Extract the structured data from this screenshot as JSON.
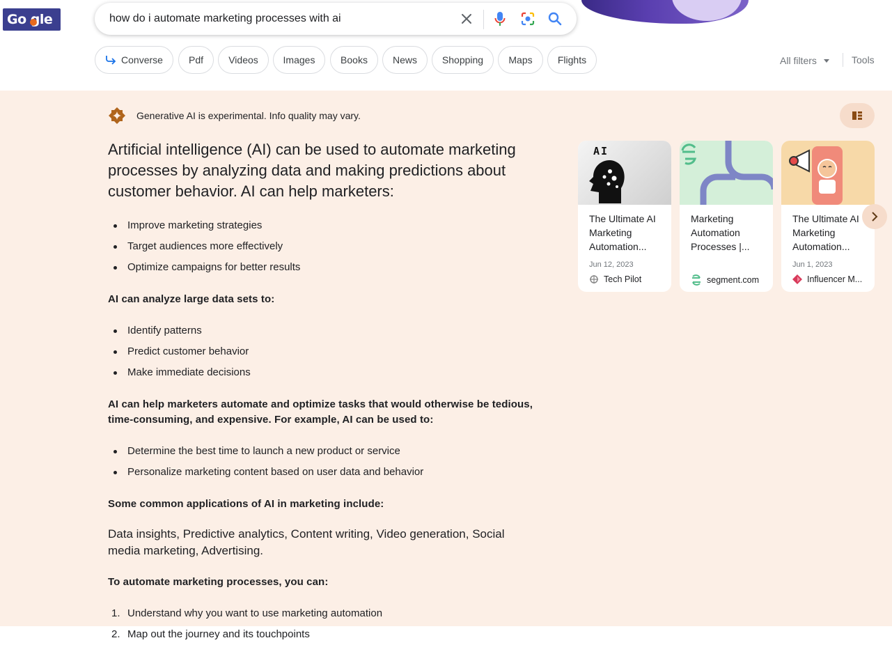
{
  "logo": {
    "text": "Go  gle"
  },
  "search": {
    "query": "how do i automate marketing processes with ai"
  },
  "chips": [
    {
      "label": "Converse"
    },
    {
      "label": "Pdf"
    },
    {
      "label": "Videos"
    },
    {
      "label": "Images"
    },
    {
      "label": "Books"
    },
    {
      "label": "News"
    },
    {
      "label": "Shopping"
    },
    {
      "label": "Maps"
    },
    {
      "label": "Flights"
    }
  ],
  "toolbar": {
    "filters_label": "All filters",
    "tools_label": "Tools"
  },
  "ai": {
    "disclaimer": "Generative AI is experimental. Info quality may vary.",
    "lead": "Artificial intelligence (AI) can be used to automate marketing processes by analyzing data and making predictions about customer behavior. AI can help marketers:",
    "list1": [
      "Improve marketing strategies",
      "Target audiences more effectively",
      "Optimize campaigns for better results"
    ],
    "sub1": "AI can analyze large data sets to:",
    "list2": [
      "Identify patterns",
      "Predict customer behavior",
      "Make immediate decisions"
    ],
    "sub2": "AI can help marketers automate and optimize tasks that would otherwise be tedious, time-consuming, and expensive. For example, AI can be used to:",
    "list3": [
      "Determine the best time to launch a new product or service",
      "Personalize marketing content based on user data and behavior"
    ],
    "sub3": "Some common applications of AI in marketing include:",
    "applications": "Data insights, Predictive analytics, Content writing, Video generation, Social media marketing, Advertising.",
    "sub4": "To automate marketing processes, you can:",
    "steps": [
      {
        "num": "1.",
        "text": "Understand why you want to use marketing automation"
      },
      {
        "num": "2.",
        "text": "Map out the journey and its touchpoints"
      }
    ]
  },
  "sources": [
    {
      "title": "The Ultimate AI Marketing Automation...",
      "date": "Jun 12, 2023",
      "site": "Tech Pilot",
      "thumb_text": "AI"
    },
    {
      "title": "Marketing Automation Processes |...",
      "date": "",
      "site": "segment.com"
    },
    {
      "title": "The Ultimate AI Marketing Automation...",
      "date": "Jun 1, 2023",
      "site": "Influencer M..."
    }
  ],
  "colors": {
    "panel_bg": "#fcefe6",
    "accent_button": "#f6dccb",
    "link_blue": "#1a73e8"
  }
}
